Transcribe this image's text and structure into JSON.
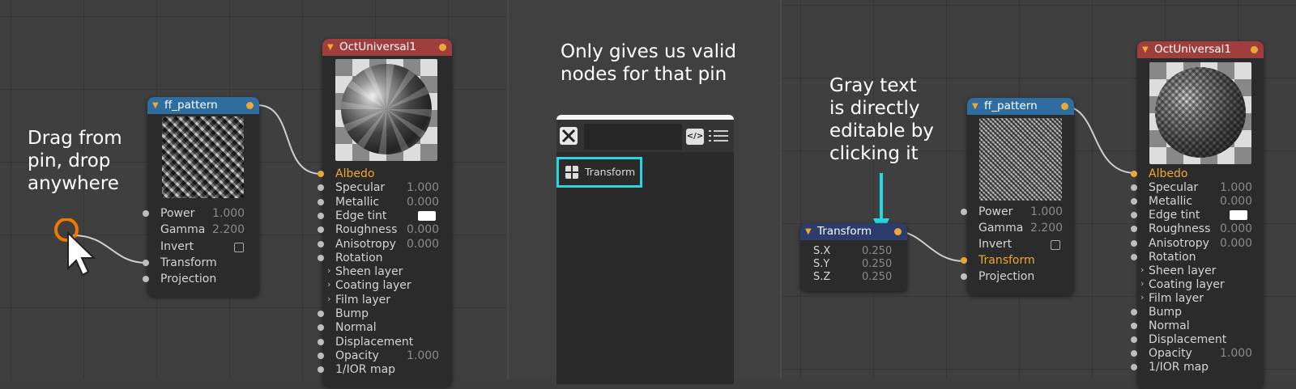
{
  "left_panel": {
    "callout": [
      "Drag from",
      "pin, drop",
      "anywhere"
    ],
    "ff_pattern": {
      "title": "ff_pattern",
      "rows": [
        {
          "label": "Power",
          "value": "1.000"
        },
        {
          "label": "Gamma",
          "value": "2.200"
        },
        {
          "label": "Invert",
          "value": ""
        },
        {
          "label": "Transform",
          "value": ""
        },
        {
          "label": "Projection",
          "value": ""
        }
      ]
    },
    "oct_universal": {
      "title": "OctUniversal1",
      "rows": [
        {
          "label": "Albedo",
          "value": ""
        },
        {
          "label": "Specular",
          "value": "1.000"
        },
        {
          "label": "Metallic",
          "value": "0.000"
        },
        {
          "label": "Edge tint",
          "value": ""
        },
        {
          "label": "Roughness",
          "value": "0.000"
        },
        {
          "label": "Anisotropy",
          "value": "0.000"
        },
        {
          "label": "Rotation",
          "value": ""
        },
        {
          "label": "Sheen layer",
          "value": ""
        },
        {
          "label": "Coating layer",
          "value": ""
        },
        {
          "label": "Film layer",
          "value": ""
        },
        {
          "label": "Bump",
          "value": ""
        },
        {
          "label": "Normal",
          "value": ""
        },
        {
          "label": "Displacement",
          "value": ""
        },
        {
          "label": "Opacity",
          "value": "1.000"
        },
        {
          "label": "1/IOR map",
          "value": ""
        }
      ]
    }
  },
  "middle_panel": {
    "callout": [
      "Only gives us valid",
      "nodes for that pin"
    ],
    "popup": {
      "item_label": "Transform"
    }
  },
  "right_panel": {
    "callout": [
      "Gray text",
      "is directly",
      "editable by",
      "clicking it"
    ],
    "transform": {
      "title": "Transform",
      "rows": [
        {
          "label": "S.X",
          "value": "0.250"
        },
        {
          "label": "S.Y",
          "value": "0.250"
        },
        {
          "label": "S.Z",
          "value": "0.250"
        }
      ]
    },
    "ff_pattern": {
      "title": "ff_pattern",
      "rows": [
        {
          "label": "Power",
          "value": "1.000"
        },
        {
          "label": "Gamma",
          "value": "2.200"
        },
        {
          "label": "Invert",
          "value": ""
        },
        {
          "label": "Transform",
          "value": ""
        },
        {
          "label": "Projection",
          "value": ""
        }
      ]
    },
    "oct_universal": {
      "title": "OctUniversal1",
      "rows": [
        {
          "label": "Albedo",
          "value": ""
        },
        {
          "label": "Specular",
          "value": "1.000"
        },
        {
          "label": "Metallic",
          "value": "0.000"
        },
        {
          "label": "Edge tint",
          "value": ""
        },
        {
          "label": "Roughness",
          "value": "0.000"
        },
        {
          "label": "Anisotropy",
          "value": "0.000"
        },
        {
          "label": "Rotation",
          "value": ""
        },
        {
          "label": "Sheen layer",
          "value": ""
        },
        {
          "label": "Coating layer",
          "value": ""
        },
        {
          "label": "Film layer",
          "value": ""
        },
        {
          "label": "Bump",
          "value": ""
        },
        {
          "label": "Normal",
          "value": ""
        },
        {
          "label": "Displacement",
          "value": ""
        },
        {
          "label": "Opacity",
          "value": "1.000"
        },
        {
          "label": "1/IOR map",
          "value": ""
        }
      ]
    }
  },
  "colors": {
    "pin_active": "#e8a838",
    "highlight": "#27d6e0",
    "drag_ring": "#f07800"
  }
}
